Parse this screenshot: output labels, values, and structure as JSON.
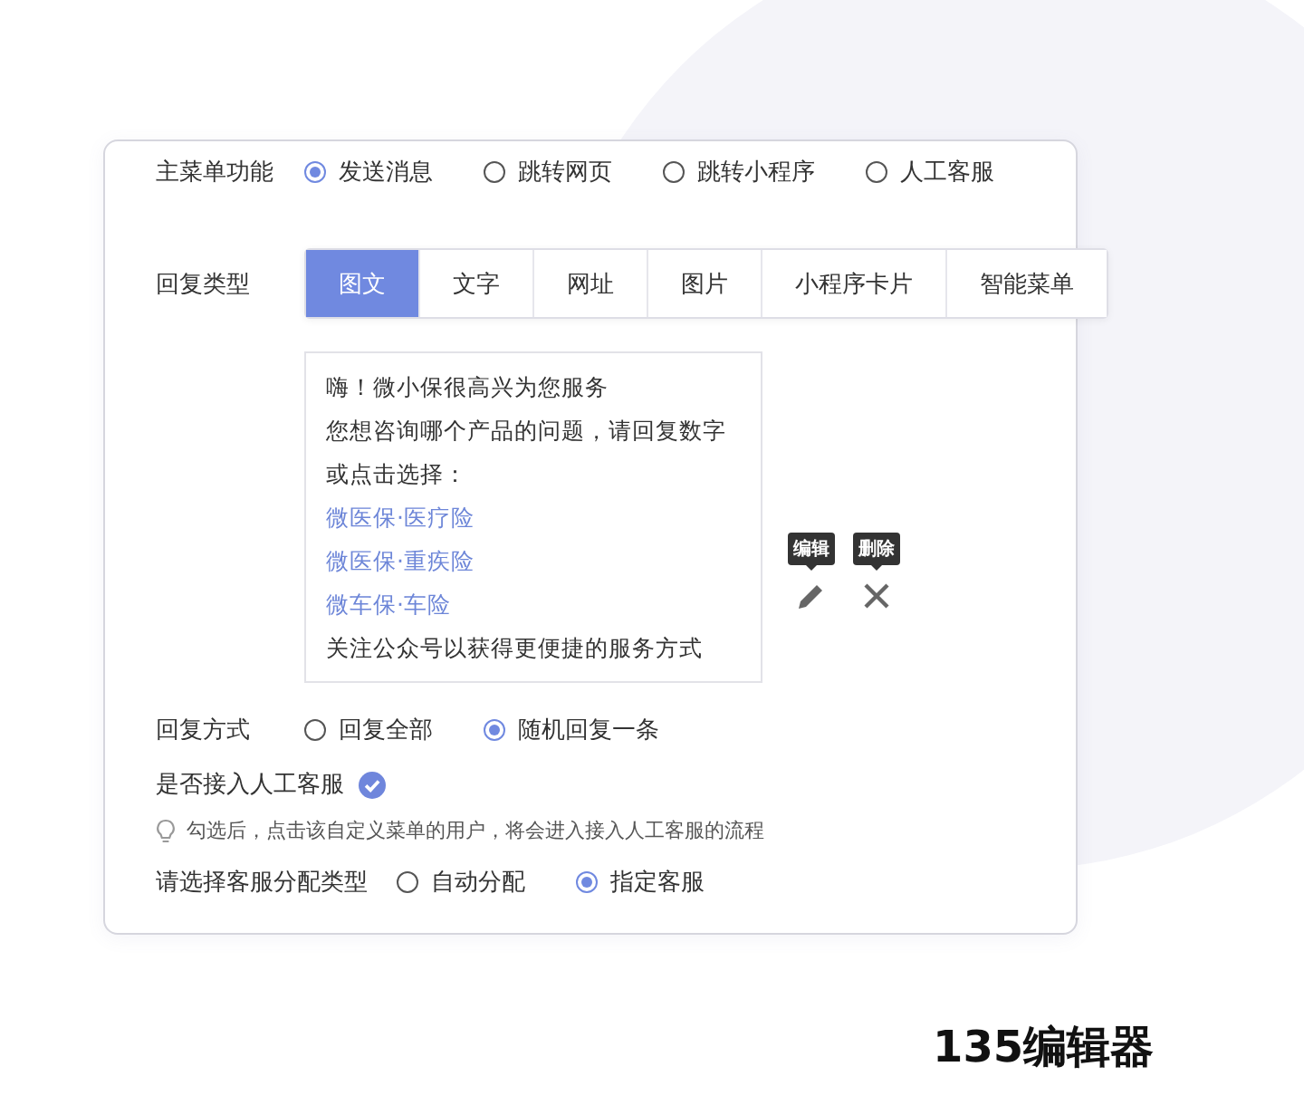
{
  "main_menu": {
    "label": "主菜单功能",
    "options": [
      {
        "label": "发送消息",
        "selected": true
      },
      {
        "label": "跳转网页",
        "selected": false
      },
      {
        "label": "跳转小程序",
        "selected": false
      },
      {
        "label": "人工客服",
        "selected": false
      }
    ]
  },
  "reply_type": {
    "label": "回复类型",
    "tabs": [
      {
        "label": "图文",
        "selected": true
      },
      {
        "label": "文字",
        "selected": false
      },
      {
        "label": "网址",
        "selected": false
      },
      {
        "label": "图片",
        "selected": false
      },
      {
        "label": "小程序卡片",
        "selected": false
      },
      {
        "label": "智能菜单",
        "selected": false
      }
    ]
  },
  "message": {
    "lines": [
      {
        "kind": "text",
        "text": "嗨！微小保很高兴为您服务"
      },
      {
        "kind": "text",
        "text": "您想咨询哪个产品的问题，请回复数字"
      },
      {
        "kind": "text",
        "text": "或点击选择："
      },
      {
        "kind": "link",
        "text": "微医保·医疗险"
      },
      {
        "kind": "link",
        "text": "微医保·重疾险"
      },
      {
        "kind": "link",
        "text": "微车保·车险"
      },
      {
        "kind": "text",
        "text": "关注公众号以获得更便捷的服务方式"
      }
    ],
    "actions": [
      {
        "kind": "edit",
        "tooltip": "编辑"
      },
      {
        "kind": "delete",
        "tooltip": "删除"
      }
    ]
  },
  "reply_mode": {
    "label": "回复方式",
    "options": [
      {
        "label": "回复全部",
        "selected": false
      },
      {
        "label": "随机回复一条",
        "selected": true
      }
    ]
  },
  "human_service": {
    "label": "是否接入人工客服",
    "checked": true,
    "hint": "勾选后，点击该自定义菜单的用户，将会进入接入人工客服的流程"
  },
  "assign": {
    "label": "请选择客服分配类型",
    "options": [
      {
        "label": "自动分配",
        "selected": false
      },
      {
        "label": "指定客服",
        "selected": true
      }
    ]
  },
  "brand": "135编辑器"
}
